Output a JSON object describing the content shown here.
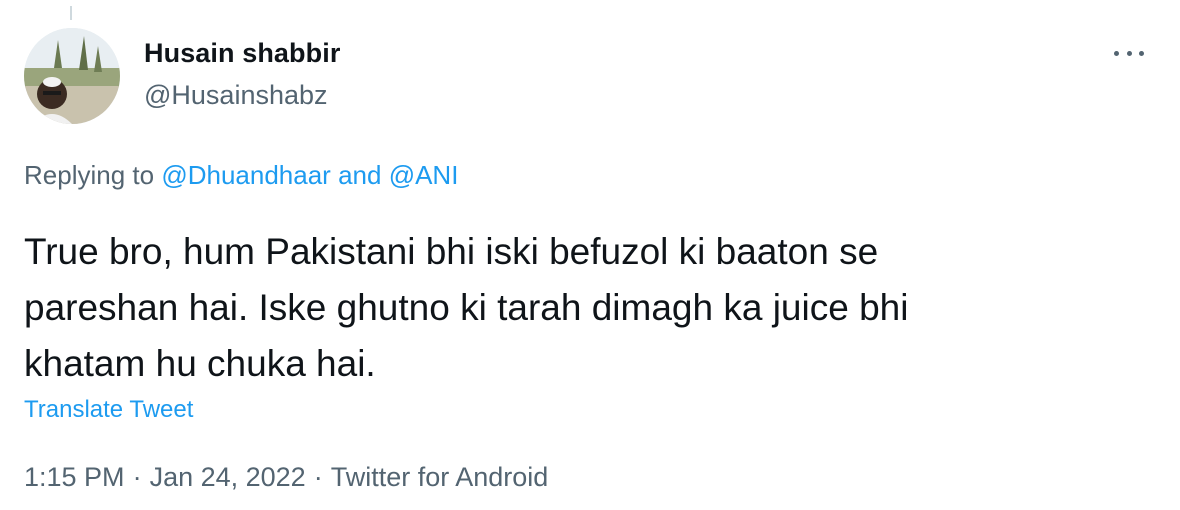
{
  "user": {
    "display_name": "Husain shabbir",
    "handle": "@Husainshabz"
  },
  "reply": {
    "prefix": "Replying to",
    "mention_1": "@Dhuandhaar",
    "conjunction": "and",
    "mention_2": "@ANI"
  },
  "tweet": {
    "lines": [
      "True bro, hum Pakistani bhi iski befuzol ki baaton se",
      "pareshan hai. Iske ghutno ki tarah dimagh ka juice bhi",
      "khatam hu chuka hai."
    ]
  },
  "translate_label": "Translate Tweet",
  "meta": {
    "time": "1:15 PM",
    "date": "Jan 24, 2022",
    "source": "Twitter for Android",
    "separator": "·"
  },
  "icons": {
    "more": "more-horizontal-icon"
  },
  "colors": {
    "text": "#0f1419",
    "secondary": "#536471",
    "link": "#1d9bf0"
  }
}
